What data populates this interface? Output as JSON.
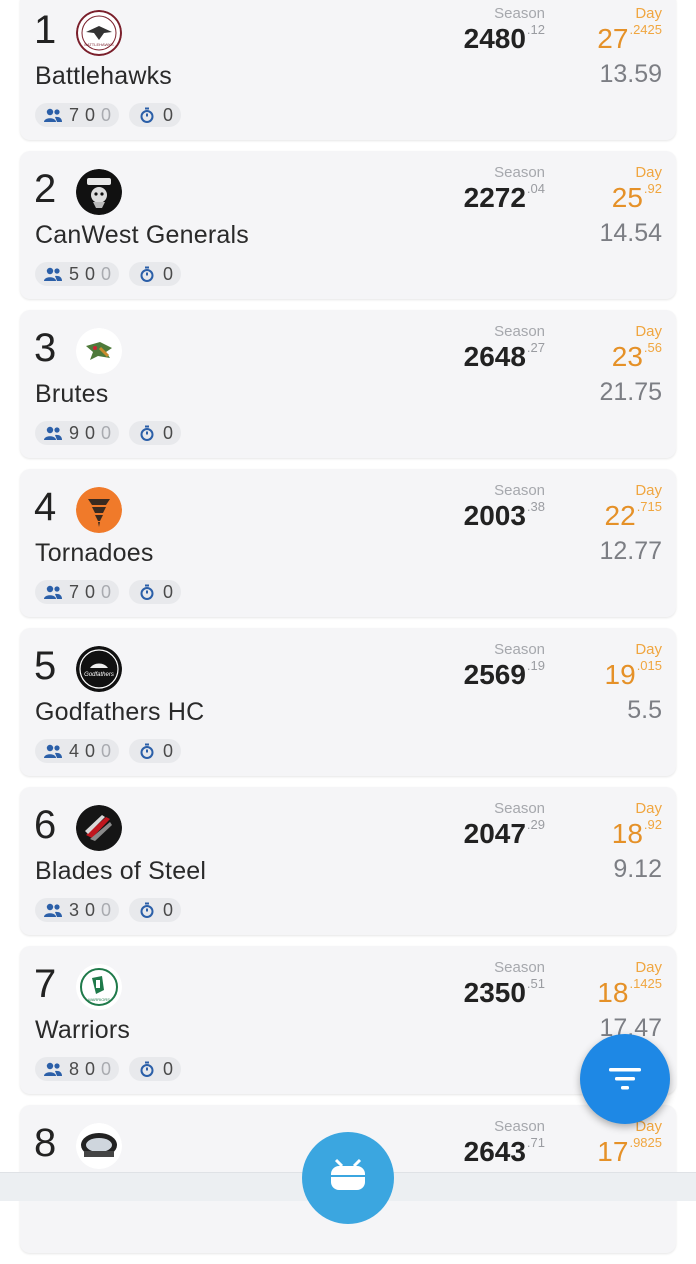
{
  "labels": {
    "season": "Season",
    "day": "Day"
  },
  "teams": [
    {
      "rank": "1",
      "name": "Battlehawks",
      "season_int": "2480",
      "season_dec": ".12",
      "day_int": "27",
      "day_dec": ".2425",
      "avg": "13.59",
      "roster_a": "7",
      "roster_b": "0",
      "roster_c": "0",
      "timer": "0",
      "logo": "battlehawks-logo"
    },
    {
      "rank": "2",
      "name": "CanWest Generals",
      "season_int": "2272",
      "season_dec": ".04",
      "day_int": "25",
      "day_dec": ".92",
      "avg": "14.54",
      "roster_a": "5",
      "roster_b": "0",
      "roster_c": "0",
      "timer": "0",
      "logo": "canwest-generals-logo"
    },
    {
      "rank": "3",
      "name": "Brutes",
      "season_int": "2648",
      "season_dec": ".27",
      "day_int": "23",
      "day_dec": ".56",
      "avg": "21.75",
      "roster_a": "9",
      "roster_b": "0",
      "roster_c": "0",
      "timer": "0",
      "logo": "brutes-logo"
    },
    {
      "rank": "4",
      "name": "Tornadoes",
      "season_int": "2003",
      "season_dec": ".38",
      "day_int": "22",
      "day_dec": ".715",
      "avg": "12.77",
      "roster_a": "7",
      "roster_b": "0",
      "roster_c": "0",
      "timer": "0",
      "logo": "tornadoes-logo"
    },
    {
      "rank": "5",
      "name": "Godfathers HC",
      "season_int": "2569",
      "season_dec": ".19",
      "day_int": "19",
      "day_dec": ".015",
      "avg": "5.5",
      "roster_a": "4",
      "roster_b": "0",
      "roster_c": "0",
      "timer": "0",
      "logo": "godfathers-logo"
    },
    {
      "rank": "6",
      "name": "Blades of Steel",
      "season_int": "2047",
      "season_dec": ".29",
      "day_int": "18",
      "day_dec": ".92",
      "avg": "9.12",
      "roster_a": "3",
      "roster_b": "0",
      "roster_c": "0",
      "timer": "0",
      "logo": "blades-of-steel-logo"
    },
    {
      "rank": "7",
      "name": "Warriors",
      "season_int": "2350",
      "season_dec": ".51",
      "day_int": "18",
      "day_dec": ".1425",
      "avg": "17.47",
      "roster_a": "8",
      "roster_b": "0",
      "roster_c": "0",
      "timer": "0",
      "logo": "warriors-logo"
    },
    {
      "rank": "8",
      "name": "",
      "season_int": "2643",
      "season_dec": ".71",
      "day_int": "17",
      "day_dec": ".9825",
      "avg": "",
      "roster_a": "",
      "roster_b": "",
      "roster_c": "",
      "timer": "",
      "logo": "team-8-logo"
    }
  ],
  "icons": {
    "filter": "filter-icon",
    "rink": "hockey-rink-icon",
    "users": "users-icon",
    "timer": "stopwatch-icon"
  },
  "colors": {
    "accent": "#1e88e5",
    "day": "#e59128",
    "card": "#f5f5f7"
  }
}
